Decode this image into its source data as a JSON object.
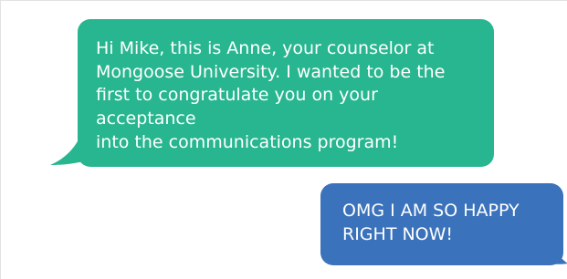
{
  "conversation": {
    "messages": [
      {
        "direction": "incoming",
        "text": "Hi Mike, this is Anne, your counselor at\nMongoose University. I wanted to be the\nfirst to congratulate you on your acceptance\ninto the communications program!",
        "color": "#27b68f"
      },
      {
        "direction": "outgoing",
        "text": "OMG I AM SO HAPPY\nRIGHT NOW!",
        "color": "#3a72bb"
      }
    ]
  }
}
